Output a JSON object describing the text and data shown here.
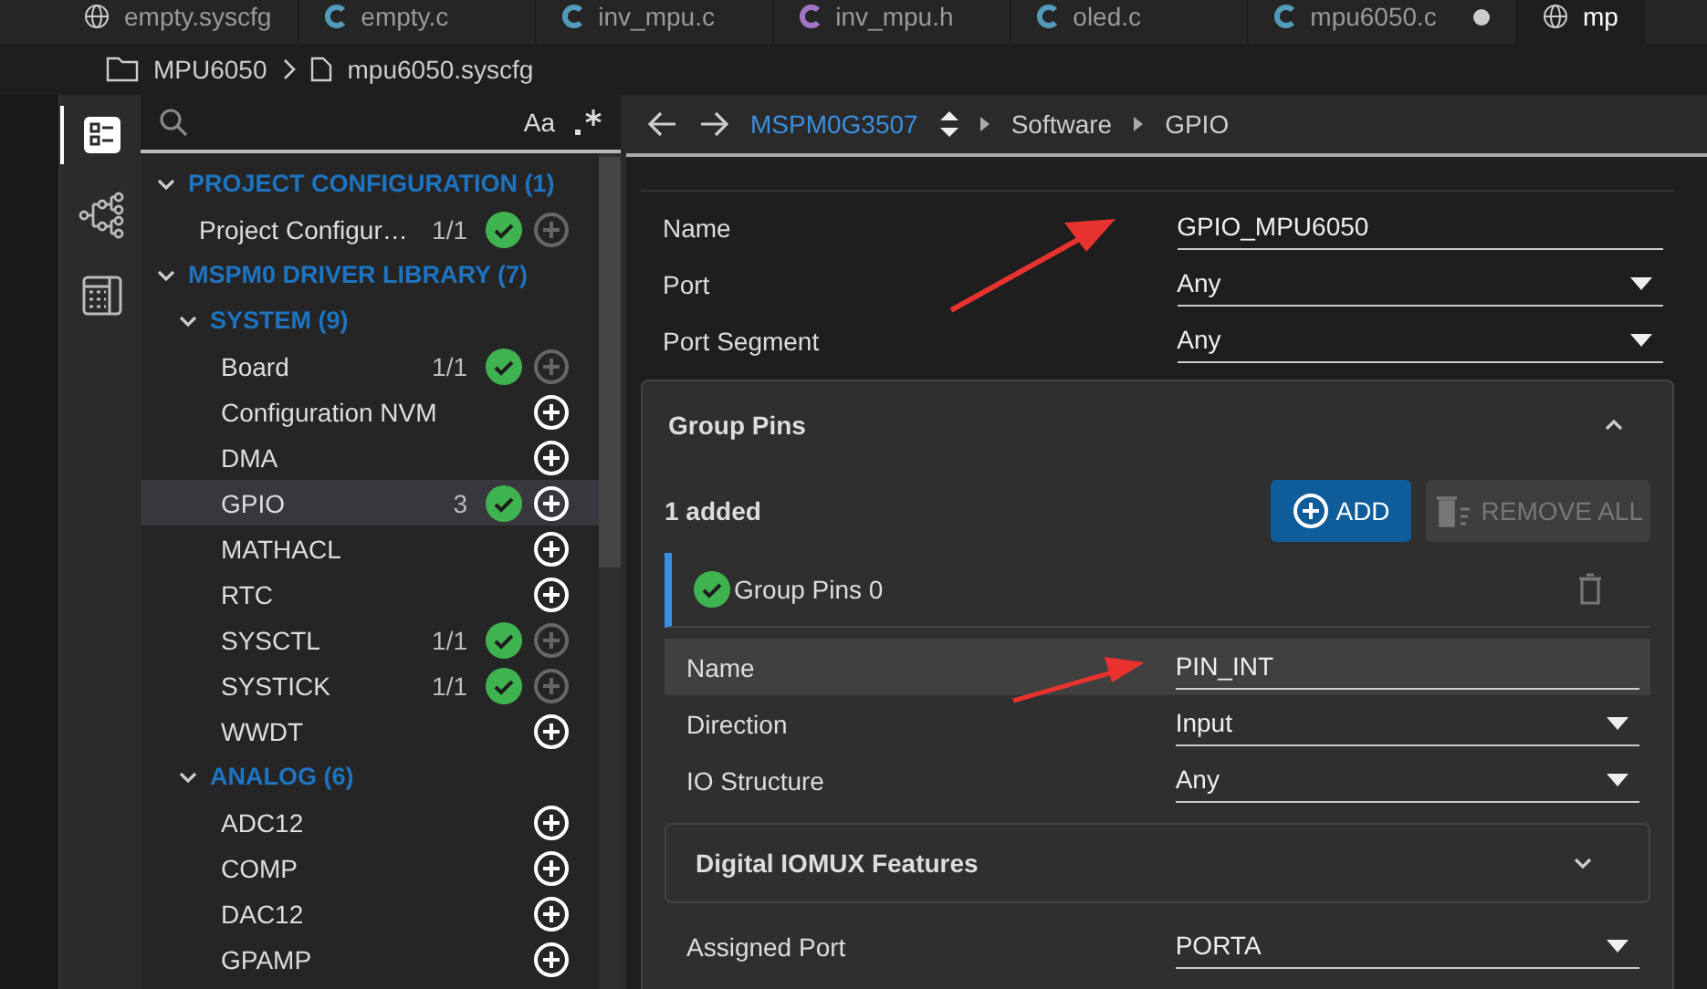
{
  "tabs": [
    {
      "label": "empty.syscfg",
      "kind": "syscfg",
      "modified": false,
      "selected": false
    },
    {
      "label": "empty.c",
      "kind": "c",
      "modified": false,
      "selected": false
    },
    {
      "label": "inv_mpu.c",
      "kind": "c",
      "modified": false,
      "selected": false
    },
    {
      "label": "inv_mpu.h",
      "kind": "h",
      "modified": false,
      "selected": false
    },
    {
      "label": "oled.c",
      "kind": "c",
      "modified": false,
      "selected": false
    },
    {
      "label": "mpu6050.c",
      "kind": "c",
      "modified": true,
      "selected": false
    },
    {
      "label": "mp",
      "kind": "syscfg",
      "modified": false,
      "selected": true
    }
  ],
  "breadcrumb": {
    "folder": "MPU6050",
    "file": "mpu6050.syscfg"
  },
  "activity_bar": [
    {
      "kind": "list",
      "selected": true
    },
    {
      "kind": "tree",
      "selected": false
    },
    {
      "kind": "calculator",
      "selected": false
    }
  ],
  "search": {
    "case_toggle": "Aa"
  },
  "tree": [
    {
      "label": "PROJECT CONFIGURATION (1)",
      "expanded": true,
      "children": [
        {
          "label": "Project Configur…",
          "count": "1/1",
          "ok": true,
          "can_add": false,
          "selected": false
        }
      ]
    },
    {
      "label": "MSPM0 DRIVER LIBRARY (7)",
      "expanded": true,
      "children": [
        {
          "label": "SYSTEM (9)",
          "expanded": true,
          "children": [
            {
              "label": "Board",
              "count": "1/1",
              "ok": true,
              "can_add": false,
              "selected": false
            },
            {
              "label": "Configuration NVM",
              "ok": false,
              "can_add": true,
              "selected": false
            },
            {
              "label": "DMA",
              "ok": false,
              "can_add": true,
              "selected": false
            },
            {
              "label": "GPIO",
              "count": "3",
              "ok": true,
              "can_add": true,
              "selected": true
            },
            {
              "label": "MATHACL",
              "ok": false,
              "can_add": true,
              "selected": false
            },
            {
              "label": "RTC",
              "ok": false,
              "can_add": true,
              "selected": false
            },
            {
              "label": "SYSCTL",
              "count": "1/1",
              "ok": true,
              "can_add": false,
              "selected": false
            },
            {
              "label": "SYSTICK",
              "count": "1/1",
              "ok": true,
              "can_add": false,
              "selected": false
            },
            {
              "label": "WWDT",
              "ok": false,
              "can_add": true,
              "selected": false
            }
          ]
        },
        {
          "label": "ANALOG (6)",
          "expanded": true,
          "children": [
            {
              "label": "ADC12",
              "ok": false,
              "can_add": true,
              "selected": false
            },
            {
              "label": "COMP",
              "ok": false,
              "can_add": true,
              "selected": false
            },
            {
              "label": "DAC12",
              "ok": false,
              "can_add": true,
              "selected": false
            },
            {
              "label": "GPAMP",
              "ok": false,
              "can_add": true,
              "selected": false
            }
          ]
        }
      ]
    }
  ],
  "nav": {
    "device": "MSPM0G3507",
    "path": [
      "Software",
      "GPIO"
    ]
  },
  "fields": [
    {
      "label": "Name",
      "value": "GPIO_MPU6050",
      "kind": "text"
    },
    {
      "label": "Port",
      "value": "Any",
      "kind": "select"
    },
    {
      "label": "Port Segment",
      "value": "Any",
      "kind": "select"
    }
  ],
  "group": {
    "title": "Group Pins",
    "expanded": true,
    "added": "1 added",
    "add_button": "ADD",
    "remove_button": "REMOVE ALL",
    "remove_disabled": true,
    "instance": {
      "title": "Group Pins 0",
      "ok": true,
      "fields": [
        {
          "label": "Name",
          "value": "PIN_INT",
          "kind": "text",
          "highlighted": true
        },
        {
          "label": "Direction",
          "value": "Input",
          "kind": "select",
          "highlighted": false
        },
        {
          "label": "IO Structure",
          "value": "Any",
          "kind": "select",
          "highlighted": false
        }
      ],
      "subsection": {
        "title": "Digital IOMUX Features",
        "expanded": false
      },
      "fields_after": [
        {
          "label": "Assigned Port",
          "value": "PORTA",
          "kind": "select",
          "highlighted": false
        }
      ]
    }
  }
}
